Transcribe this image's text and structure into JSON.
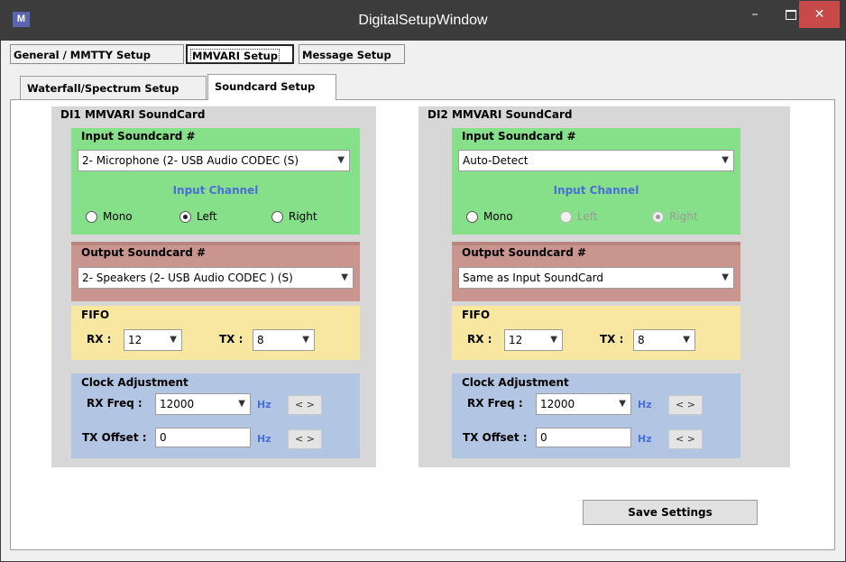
{
  "window": {
    "title": "DigitalSetupWindow",
    "icon_text": "M",
    "minimize_glyph": "–",
    "close_glyph": "✕"
  },
  "top_tabs": [
    {
      "label": "General / MMTTY Setup",
      "selected": false
    },
    {
      "label": "MMVARI Setup",
      "selected": true
    },
    {
      "label": "Message Setup",
      "selected": false
    }
  ],
  "sub_tabs": [
    {
      "label": "Waterfall/Spectrum Setup",
      "selected": false
    },
    {
      "label": "Soundcard Setup",
      "selected": true
    }
  ],
  "panels": [
    {
      "title": "DI1 MMVARI SoundCard",
      "input_title": "Input Soundcard #",
      "input_device": "2- Microphone (2- USB Audio CODEC  (S)",
      "channel_title": "Input Channel",
      "channels": {
        "mono": "Mono",
        "left": "Left",
        "right": "Right"
      },
      "channel_selected": "left",
      "channel_disabled": false,
      "output_title": "Output Soundcard #",
      "output_device": "2- Speakers (2- USB Audio CODEC ) (S)",
      "fifo_title": "FIFO",
      "rx_label": "RX :",
      "rx_value": "12",
      "tx_label": "TX :",
      "tx_value": "8",
      "clock_title": "Clock Adjustment",
      "rx_freq_label": "RX Freq :",
      "rx_freq_value": "12000",
      "tx_offset_label": "TX Offset :",
      "tx_offset_value": "0",
      "hz": "Hz",
      "nav": "< >"
    },
    {
      "title": "DI2 MMVARI SoundCard",
      "input_title": "Input Soundcard #",
      "input_device": "Auto-Detect",
      "channel_title": "Input Channel",
      "channels": {
        "mono": "Mono",
        "left": "Left",
        "right": "Right"
      },
      "channel_selected": "right",
      "channel_disabled": true,
      "output_title": "Output Soundcard #",
      "output_device": "Same as Input SoundCard",
      "fifo_title": "FIFO",
      "rx_label": "RX :",
      "rx_value": "12",
      "tx_label": "TX :",
      "tx_value": "8",
      "clock_title": "Clock Adjustment",
      "rx_freq_label": "RX Freq :",
      "rx_freq_value": "12000",
      "tx_offset_label": "TX Offset :",
      "tx_offset_value": "0",
      "hz": "Hz",
      "nav": "< >"
    }
  ],
  "save_button": "Save Settings",
  "colors": {
    "title_bar": "#3c3c3c",
    "input_group": "#86e08a",
    "output_group": "#c9958e",
    "fifo_group": "#f7e7a1",
    "clock_group": "#b2c5e2",
    "channel_label": "#4a6fd6",
    "close_button": "#c74949"
  },
  "icons": [
    "app-icon",
    "minimize-icon",
    "maximize-icon",
    "close-icon",
    "chevron-down-icon"
  ]
}
